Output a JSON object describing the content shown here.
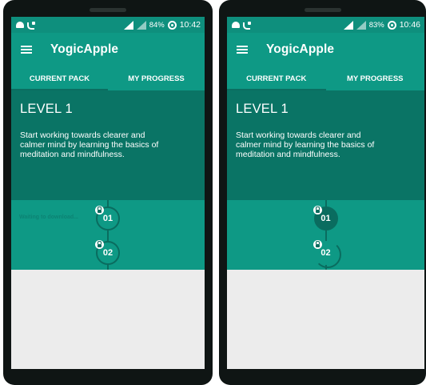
{
  "screens": [
    {
      "status_bar": {
        "battery": "84%",
        "time": "10:42"
      },
      "app_bar": {
        "title": "YogicApple"
      },
      "tabs": [
        "CURRENT PACK",
        "MY PROGRESS"
      ],
      "level": {
        "title": "LEVEL 1",
        "description": "Start working towards clearer and calmer mind by learning the basics of meditation and mindfulness."
      },
      "lessons": [
        {
          "number": "01",
          "status": "Waiting to download..."
        },
        {
          "number": "02"
        }
      ]
    },
    {
      "status_bar": {
        "battery": "83%",
        "time": "10:46"
      },
      "app_bar": {
        "title": "YogicApple"
      },
      "tabs": [
        "CURRENT PACK",
        "MY PROGRESS"
      ],
      "level": {
        "title": "LEVEL 1",
        "description": "Start working towards clearer and calmer mind by learning the basics of meditation and mindfulness."
      },
      "lessons": [
        {
          "number": "01"
        },
        {
          "number": "02"
        }
      ]
    }
  ],
  "icons": {
    "status_left": [
      "android-icon",
      "phone-icon"
    ],
    "status_right": [
      "signal-icon",
      "signal-icon",
      "sync-icon"
    ],
    "app_bar": "menu-icon",
    "lesson": "lock-icon"
  },
  "colors": {
    "primary": "#0e9985",
    "primary_dark": "#0a7465",
    "status_bar": "#0e8f7d",
    "background": "#ececec"
  }
}
